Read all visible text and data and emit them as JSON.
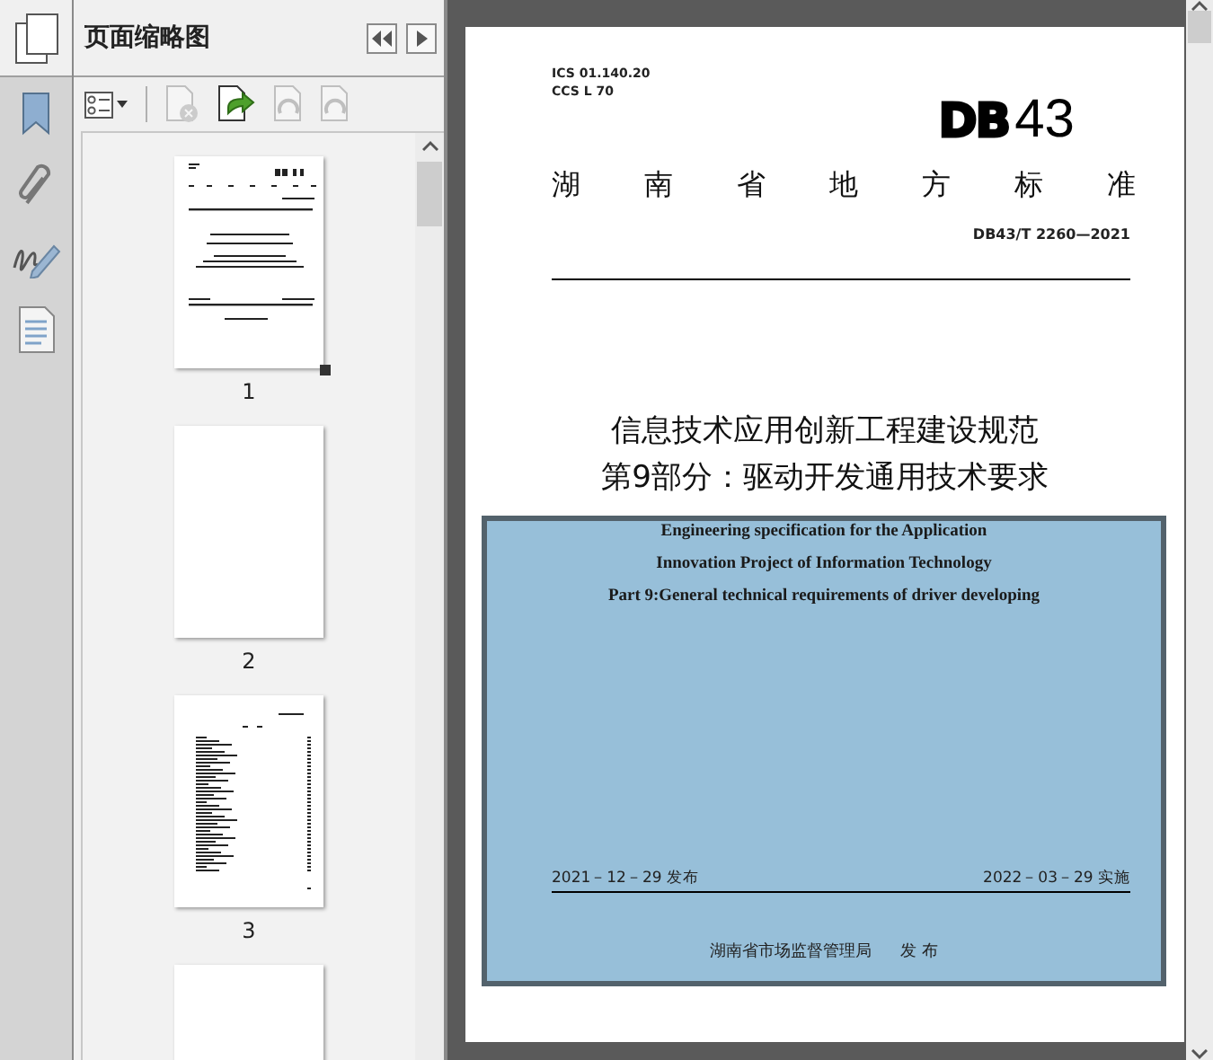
{
  "sidebar": {
    "items": [
      {
        "kind": "pages",
        "selected": true
      },
      {
        "kind": "bookmarks",
        "selected": false
      },
      {
        "kind": "attachments",
        "selected": false
      },
      {
        "kind": "signatures",
        "selected": false
      },
      {
        "kind": "layers",
        "selected": false
      }
    ]
  },
  "panel": {
    "title": "页面缩略图",
    "tools": [
      {
        "kind": "options",
        "disabled": false
      },
      {
        "kind": "delete",
        "disabled": true
      },
      {
        "kind": "extract",
        "disabled": false
      },
      {
        "kind": "rotate",
        "disabled": true
      },
      {
        "kind": "rotate",
        "disabled": true
      }
    ],
    "thumbnails": [
      {
        "kind": "cover",
        "label": "1",
        "selected": true
      },
      {
        "kind": "blank",
        "label": "2",
        "selected": false
      },
      {
        "kind": "contents",
        "label": "3",
        "selected": false
      },
      {
        "kind": "blank"
      }
    ]
  },
  "document": {
    "codes": [
      "ICS 01.140.20",
      "CCS L 70"
    ],
    "logo": {
      "mark": "DB",
      "number": "43"
    },
    "category": "湖南省地方标准",
    "standard_number": "DB43/T 2260—2021",
    "title_lines": [
      "信息技术应用创新工程建设规范",
      "第9部分：驱动开发通用技术要求"
    ],
    "english_title_lines": [
      "Engineering specification for the Application",
      "Innovation Project of Information Technology",
      "Part 9:General technical requirements of driver developing"
    ],
    "issue_date": "2021－12－29 发布",
    "effective_date": "2022－03－29 实施",
    "issuer": "湖南省市场监督管理局",
    "issuer_action": "发 布"
  }
}
